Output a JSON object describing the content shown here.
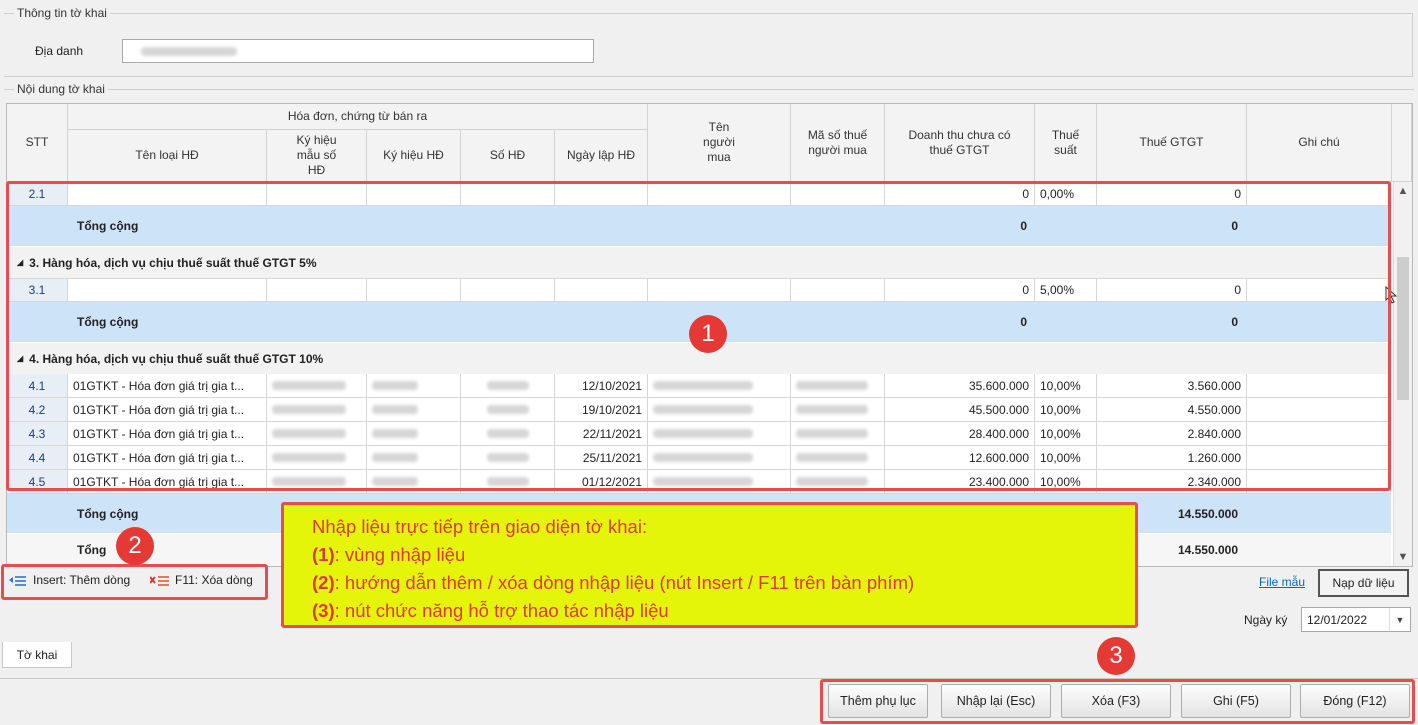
{
  "group_info": {
    "legend": "Thông tin tờ khai",
    "dia_danh_label": "Địa danh"
  },
  "group_content": {
    "legend": "Nội dung tờ khai"
  },
  "headers": {
    "stt": "STT",
    "invoice_group": "Hóa đơn, chứng từ bán ra",
    "ten_loai_hd": "Tên loại HĐ",
    "ky_hieu_mau": "Ký hiệu mẫu số HĐ",
    "ky_hieu_hd": "Ký hiệu HĐ",
    "so_hd": "Số HĐ",
    "ngay_lap": "Ngày lập HĐ",
    "ten_nguoi_mua": "Tên người mua",
    "mst_nguoi_mua": "Mã số thuế người mua",
    "doanh_thu": "Doanh thu chưa có thuế GTGT",
    "thue_suat": "Thuế suất",
    "thue_gtgt": "Thuế GTGT",
    "ghi_chu": "Ghi chú"
  },
  "rows": {
    "r21": {
      "stt": "2.1",
      "doanh_thu": "0",
      "thue_suat": "0,00%",
      "thue": "0"
    },
    "total2": {
      "label": "Tổng cộng",
      "doanh_thu": "0",
      "thue": "0"
    },
    "group3": "3. Hàng hóa, dịch vụ chịu thuế suất thuế GTGT 5%",
    "r31": {
      "stt": "3.1",
      "doanh_thu": "0",
      "thue_suat": "5,00%",
      "thue": "0"
    },
    "total3": {
      "label": "Tổng cộng",
      "doanh_thu": "0",
      "thue": "0"
    },
    "group4": "4. Hàng hóa, dịch vụ chịu thuế suất thuế GTGT 10%",
    "items4": [
      {
        "stt": "4.1",
        "ten": "01GTKT - Hóa đơn giá trị gia t...",
        "ngay": "12/10/2021",
        "doanh_thu": "35.600.000",
        "thue_suat": "10,00%",
        "thue": "3.560.000"
      },
      {
        "stt": "4.2",
        "ten": "01GTKT - Hóa đơn giá trị gia t...",
        "ngay": "19/10/2021",
        "doanh_thu": "45.500.000",
        "thue_suat": "10,00%",
        "thue": "4.550.000"
      },
      {
        "stt": "4.3",
        "ten": "01GTKT - Hóa đơn giá trị gia t...",
        "ngay": "22/11/2021",
        "doanh_thu": "28.400.000",
        "thue_suat": "10,00%",
        "thue": "2.840.000"
      },
      {
        "stt": "4.4",
        "ten": "01GTKT - Hóa đơn giá trị gia t...",
        "ngay": "25/11/2021",
        "doanh_thu": "12.600.000",
        "thue_suat": "10,00%",
        "thue": "1.260.000"
      },
      {
        "stt": "4.5",
        "ten": "01GTKT - Hóa đơn giá trị gia t...",
        "ngay": "01/12/2021",
        "doanh_thu": "23.400.000",
        "thue_suat": "10,00%",
        "thue": "2.340.000"
      }
    ],
    "total4": {
      "label": "Tổng cộng",
      "thue": "14.550.000"
    },
    "grand": {
      "label": "Tổng",
      "thue": "14.550.000"
    }
  },
  "toolbar": {
    "insert_hint": "Insert: Thêm dòng",
    "delete_hint": "F11: Xóa dòng",
    "file_mau": "File mẫu",
    "nap_du_lieu": "Nạp dữ liệu"
  },
  "ngay_ky": {
    "label": "Ngày ký",
    "value": "12/01/2022"
  },
  "tab": "Tờ khai",
  "buttons": {
    "them_phu_luc": "Thêm phụ lục",
    "nhap_lai": "Nhập lại (Esc)",
    "xoa": "Xóa (F3)",
    "ghi": "Ghi (F5)",
    "dong": "Đóng (F12)"
  },
  "annotation": {
    "badges": [
      "1",
      "2",
      "3"
    ],
    "title": "Nhập liệu trực tiếp trên giao diện tờ khai:",
    "l1_key": "(1)",
    "l1_text": ": vùng nhập liệu",
    "l2_key": "(2)",
    "l2_text": ": hướng dẫn thêm / xóa dòng nhập liệu (nút Insert / F11 trên bàn phím)",
    "l3_key": "(3)",
    "l3_text": ": nút chức năng hỗ trợ thao tác nhập liệu"
  },
  "colors": {
    "total_row": "#cde3f7",
    "annotation_red": "#e53935",
    "note_bg": "#e5f50a"
  }
}
